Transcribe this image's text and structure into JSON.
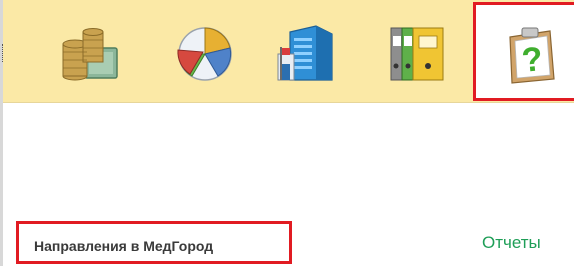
{
  "toolbar": {
    "buttons": [
      {
        "name": "finance-icon"
      },
      {
        "name": "pie-chart-icon"
      },
      {
        "name": "building-icon"
      },
      {
        "name": "folders-icon"
      },
      {
        "name": "help-clipboard-icon"
      }
    ],
    "background_color": "#fbe9a6",
    "highlight_color": "#e11b22"
  },
  "main": {
    "link": "Направления в МедГород",
    "reports": "Отчеты",
    "reports_color": "#1e9e57"
  }
}
